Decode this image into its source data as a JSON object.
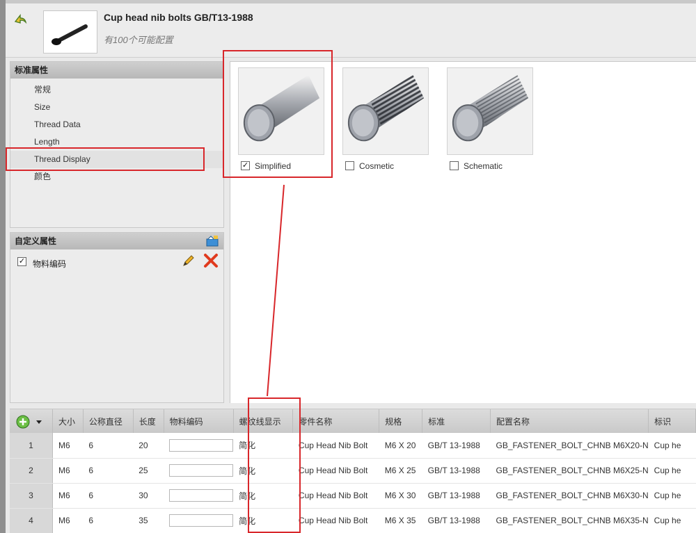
{
  "header": {
    "title": "Cup head nib bolts GB/T13-1988",
    "subtitle": "有100个可能配置"
  },
  "standard_panel": {
    "title": "标准属性",
    "items": [
      "常规",
      "Size",
      "Thread Data",
      "Length",
      "Thread Display",
      "颜色"
    ],
    "active_index": 4
  },
  "custom_panel": {
    "title": "自定义属性",
    "items": [
      {
        "label": "物料编码",
        "checked": true
      }
    ]
  },
  "display_options": [
    {
      "label": "Simplified",
      "checked": true
    },
    {
      "label": "Cosmetic",
      "checked": false
    },
    {
      "label": "Schematic",
      "checked": false
    }
  ],
  "grid": {
    "columns": [
      "大小",
      "公称直径",
      "长度",
      "物料编码",
      "螺纹线显示",
      "零件名称",
      "规格",
      "标准",
      "配置名称",
      "标识"
    ],
    "rows": [
      {
        "n": "1",
        "size": "M6",
        "dia": "6",
        "len": "20",
        "thread": "简化",
        "part": "Cup Head Nib Bolt",
        "spec": "M6 X 20",
        "std": "GB/T 13-1988",
        "config": "GB_FASTENER_BOLT_CHNB M6X20-N",
        "id": "Cup he"
      },
      {
        "n": "2",
        "size": "M6",
        "dia": "6",
        "len": "25",
        "thread": "简化",
        "part": "Cup Head Nib Bolt",
        "spec": "M6 X 25",
        "std": "GB/T 13-1988",
        "config": "GB_FASTENER_BOLT_CHNB M6X25-N",
        "id": "Cup he"
      },
      {
        "n": "3",
        "size": "M6",
        "dia": "6",
        "len": "30",
        "thread": "简化",
        "part": "Cup Head Nib Bolt",
        "spec": "M6 X 30",
        "std": "GB/T 13-1988",
        "config": "GB_FASTENER_BOLT_CHNB M6X30-N",
        "id": "Cup he"
      },
      {
        "n": "4",
        "size": "M6",
        "dia": "6",
        "len": "35",
        "thread": "简化",
        "part": "Cup Head Nib Bolt",
        "spec": "M6 X 35",
        "std": "GB/T 13-1988",
        "config": "GB_FASTENER_BOLT_CHNB M6X35-N",
        "id": "Cup he"
      }
    ]
  },
  "colors": {
    "annotation_red": "#d8262a",
    "panel_header": "#c4c4c4"
  },
  "icons": [
    "back-arrow-icon",
    "bolt-thumbnail",
    "add-property-icon",
    "edit-pencil-icon",
    "delete-x-icon",
    "grid-menu-icon"
  ]
}
